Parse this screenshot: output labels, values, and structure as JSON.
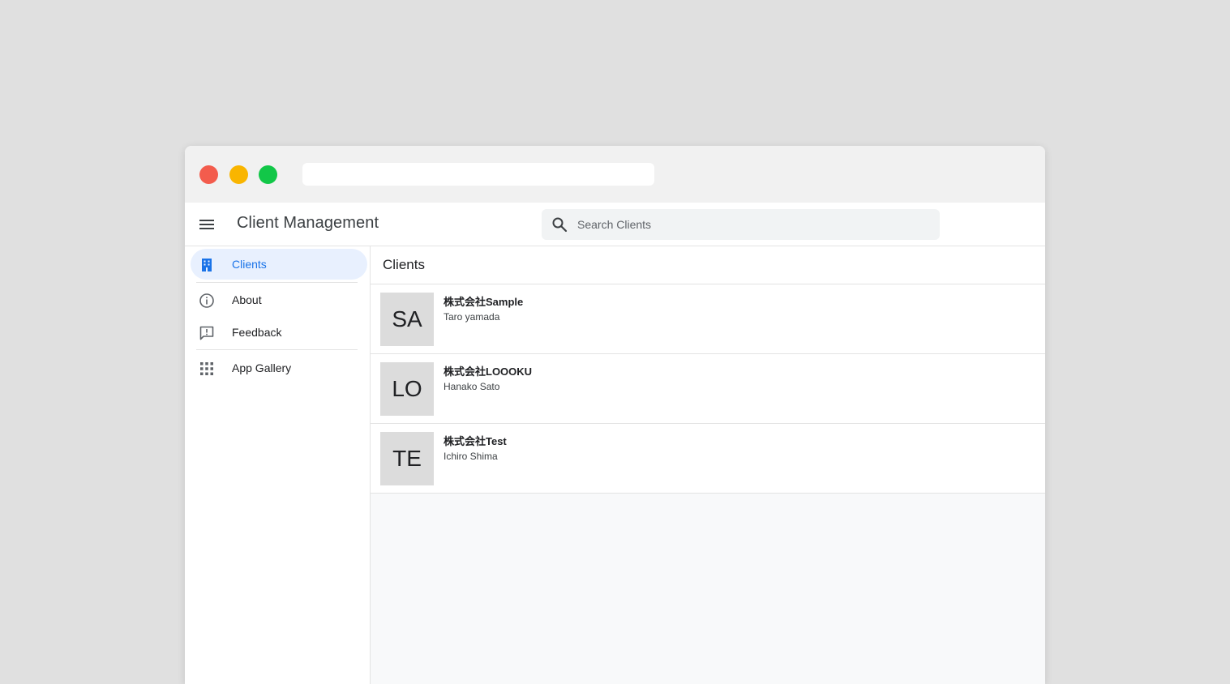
{
  "window": {
    "url": ""
  },
  "appbar": {
    "menu_icon": "hamburger-menu-icon",
    "title": "Client Management",
    "search": {
      "icon": "search-icon",
      "placeholder": "Search Clients",
      "value": ""
    }
  },
  "sidebar": {
    "items": [
      {
        "label": "Clients",
        "icon": "building-icon",
        "active": true
      },
      {
        "label": "About",
        "icon": "info-icon",
        "active": false
      },
      {
        "label": "Feedback",
        "icon": "feedback-icon",
        "active": false
      },
      {
        "label": "App Gallery",
        "icon": "apps-grid-icon",
        "active": false
      }
    ]
  },
  "main": {
    "title": "Clients",
    "clients": [
      {
        "initials": "SA",
        "name": "株式会社Sample",
        "contact": "Taro yamada"
      },
      {
        "initials": "LO",
        "name": "株式会社LOOOKU",
        "contact": "Hanako Sato"
      },
      {
        "initials": "TE",
        "name": "株式会社Test",
        "contact": "Ichiro Shima"
      }
    ]
  },
  "colors": {
    "accent": "#1a73e8",
    "active_nav_bg": "#e8f0fe",
    "traffic_red": "#f35c4d",
    "traffic_yellow": "#f9b500",
    "traffic_green": "#12c748"
  }
}
